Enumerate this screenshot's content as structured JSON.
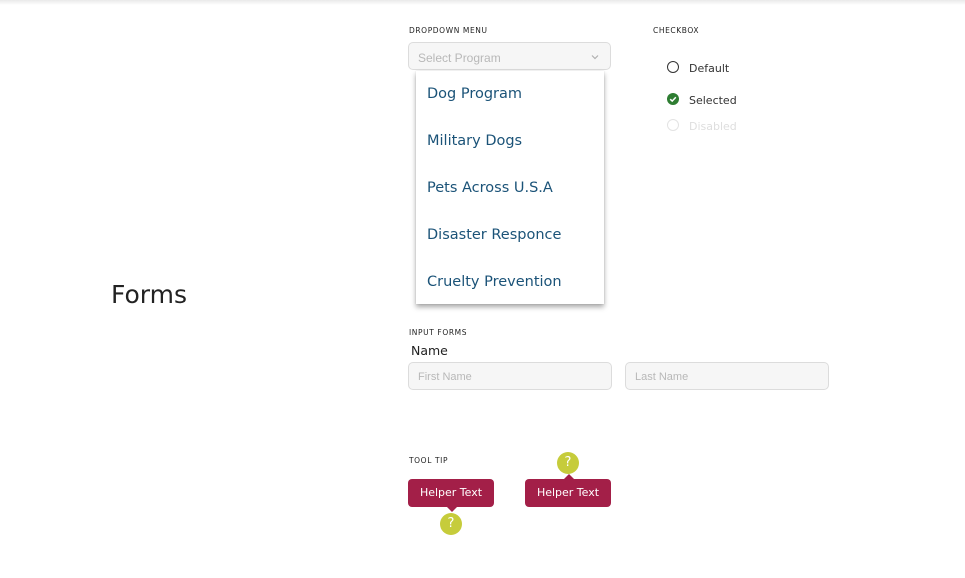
{
  "page": {
    "title": "Forms"
  },
  "dropdown": {
    "section_label": "DROPDOWN MENU",
    "placeholder": "Select Program",
    "options": [
      "Dog Program",
      "Military Dogs",
      "Pets Across U.S.A",
      "Disaster Responce",
      "Cruelty Prevention"
    ]
  },
  "checkbox": {
    "section_label": "CHECKBOX",
    "items": [
      {
        "label": "Default",
        "state": "unchecked"
      },
      {
        "label": "Selected",
        "state": "checked"
      },
      {
        "label": "Disabled",
        "state": "disabled"
      }
    ],
    "checked_color": "#2e7d32"
  },
  "input_forms": {
    "section_label": "INPUT FORMS",
    "group_label": "Name",
    "first_name_placeholder": "First Name",
    "last_name_placeholder": "Last Name"
  },
  "tooltip": {
    "section_label": "TOOL TIP",
    "items": [
      {
        "text": "Helper Text",
        "icon_position": "below"
      },
      {
        "text": "Helper Text",
        "icon_position": "above"
      }
    ],
    "icon": "?",
    "tip_color": "#a31f48",
    "icon_color": "#c6cc3b"
  }
}
